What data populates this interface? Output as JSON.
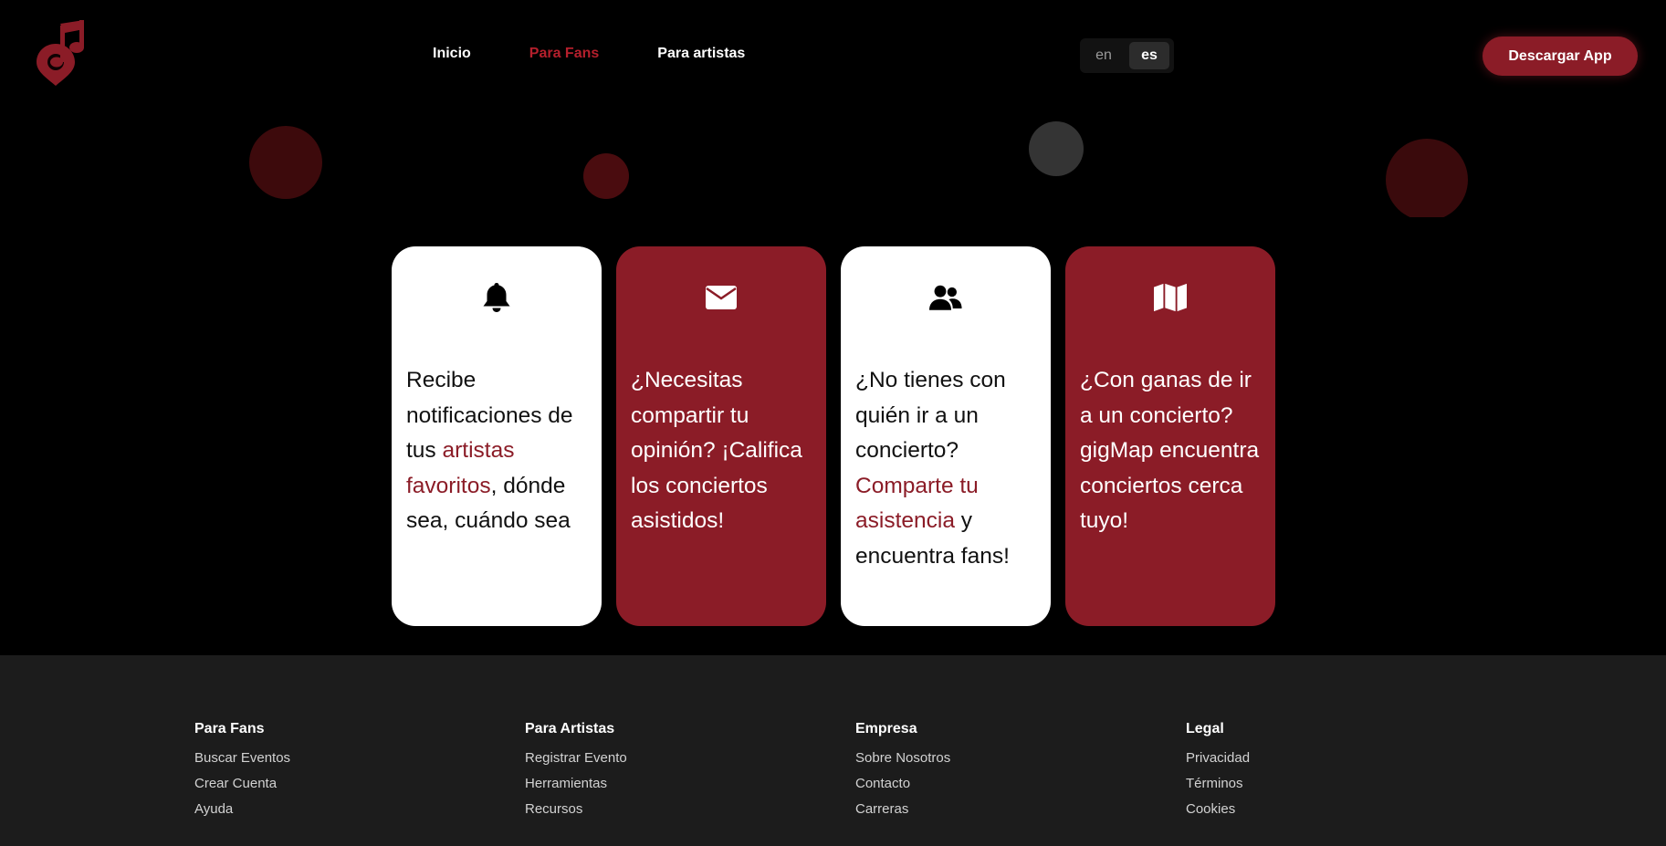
{
  "nav": {
    "links": [
      "Inicio",
      "Para Fans",
      "Para artistas"
    ],
    "active_index": 1
  },
  "lang": {
    "en": "en",
    "es": "es",
    "selected": "es"
  },
  "header": {
    "download_label": "Descargar App"
  },
  "colors": {
    "accent": "#8b1c27",
    "background": "#000000",
    "footer_bg": "#1c1c1c",
    "card_light": "#ffffff"
  },
  "icons": [
    "bell-icon",
    "envelope-icon",
    "users-icon",
    "map-icon"
  ],
  "cards": [
    {
      "icon": "bell-icon",
      "style": "light",
      "t1": "Recibe notificaciones de tus ",
      "hl": "artistas favoritos",
      "t2": ", dónde sea, cuándo sea"
    },
    {
      "icon": "envelope-icon",
      "style": "dark",
      "t1": "¿Necesitas compartir tu opinión? ¡Califica los conciertos asistidos!",
      "hl": "",
      "t2": ""
    },
    {
      "icon": "users-icon",
      "style": "light",
      "t1": "¿No tienes con quién ir a un concierto? ",
      "hl": "Comparte tu asistencia",
      "t2": " y encuentra fans!"
    },
    {
      "icon": "map-icon",
      "style": "dark",
      "t1": "¿Con ganas de ir a un concierto? gigMap encuentra conciertos cerca tuyo!",
      "hl": "",
      "t2": ""
    }
  ],
  "footer": {
    "columns": [
      {
        "title": "Para Fans",
        "links": [
          "Buscar Eventos",
          "Crear Cuenta",
          "Ayuda"
        ]
      },
      {
        "title": "Para Artistas",
        "links": [
          "Registrar Evento",
          "Herramientas",
          "Recursos"
        ]
      },
      {
        "title": "Empresa",
        "links": [
          "Sobre Nosotros",
          "Contacto",
          "Carreras"
        ]
      },
      {
        "title": "Legal",
        "links": [
          "Privacidad",
          "Términos",
          "Cookies"
        ]
      }
    ]
  }
}
